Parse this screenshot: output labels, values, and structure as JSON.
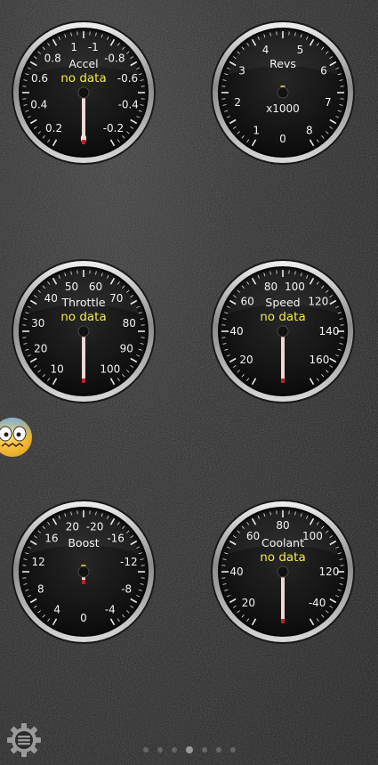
{
  "gauges": [
    {
      "id": "accel",
      "title": "Accel",
      "subtitle": "",
      "value": "no data",
      "labels": [
        {
          "text": "1",
          "angle": -12
        },
        {
          "text": "-1",
          "angle": 12
        },
        {
          "text": "0.8",
          "angle": -42
        },
        {
          "text": "-0.8",
          "angle": 42
        },
        {
          "text": "0.6",
          "angle": -72
        },
        {
          "text": "-0.6",
          "angle": 72
        },
        {
          "text": "0.4",
          "angle": -105
        },
        {
          "text": "-0.4",
          "angle": 105
        },
        {
          "text": "0.2",
          "angle": -140
        },
        {
          "text": "-0.2",
          "angle": 140
        },
        {
          "text": "0",
          "angle": 180
        }
      ],
      "needle_angle": 180
    },
    {
      "id": "revs",
      "title": "Revs",
      "subtitle": "x1000",
      "value": "-",
      "labels": [
        {
          "text": "4",
          "angle": -22
        },
        {
          "text": "5",
          "angle": 22
        },
        {
          "text": "3",
          "angle": -62
        },
        {
          "text": "6",
          "angle": 62
        },
        {
          "text": "2",
          "angle": -102
        },
        {
          "text": "7",
          "angle": 102
        },
        {
          "text": "1",
          "angle": -145
        },
        {
          "text": "8",
          "angle": 145
        },
        {
          "text": "0",
          "angle": 180
        }
      ],
      "needle_angle": null
    },
    {
      "id": "throttle",
      "title": "Throttle",
      "subtitle": "",
      "value": "no data",
      "labels": [
        {
          "text": "50",
          "angle": -15
        },
        {
          "text": "60",
          "angle": 15
        },
        {
          "text": "40",
          "angle": -45
        },
        {
          "text": "70",
          "angle": 45
        },
        {
          "text": "30",
          "angle": -80
        },
        {
          "text": "80",
          "angle": 80
        },
        {
          "text": "20",
          "angle": -112
        },
        {
          "text": "90",
          "angle": 112
        },
        {
          "text": "10",
          "angle": -145
        },
        {
          "text": "100",
          "angle": 145
        }
      ],
      "needle_angle": 180
    },
    {
      "id": "speed",
      "title": "Speed",
      "subtitle": "",
      "value": "no data",
      "labels": [
        {
          "text": "80",
          "angle": -15
        },
        {
          "text": "100",
          "angle": 15
        },
        {
          "text": "60",
          "angle": -50
        },
        {
          "text": "120",
          "angle": 50
        },
        {
          "text": "40",
          "angle": -90
        },
        {
          "text": "140",
          "angle": 90
        },
        {
          "text": "20",
          "angle": -128
        },
        {
          "text": "160",
          "angle": 128
        }
      ],
      "needle_angle": 180
    },
    {
      "id": "boost",
      "title": "Boost",
      "subtitle": "",
      "value": "-",
      "labels": [
        {
          "text": "20",
          "angle": -14
        },
        {
          "text": "-20",
          "angle": 14
        },
        {
          "text": "16",
          "angle": -44
        },
        {
          "text": "-16",
          "angle": 44
        },
        {
          "text": "12",
          "angle": -78
        },
        {
          "text": "-12",
          "angle": 78
        },
        {
          "text": "8",
          "angle": -112
        },
        {
          "text": "-8",
          "angle": 112
        },
        {
          "text": "4",
          "angle": -145
        },
        {
          "text": "-4",
          "angle": 145
        },
        {
          "text": "0",
          "angle": 180
        }
      ],
      "needle_angle": 180,
      "needle_short": true
    },
    {
      "id": "coolant",
      "title": "Coolant",
      "subtitle": "",
      "value": "no data",
      "labels": [
        {
          "text": "80",
          "angle": 0
        },
        {
          "text": "60",
          "angle": -40
        },
        {
          "text": "100",
          "angle": 40
        },
        {
          "text": "40",
          "angle": -90
        },
        {
          "text": "120",
          "angle": 90
        },
        {
          "text": "20",
          "angle": -132
        },
        {
          "text": "-40",
          "angle": 132
        }
      ],
      "needle_angle": 180
    }
  ],
  "pager": {
    "count": 7,
    "active": 3
  },
  "icons": {
    "settings": "settings-gear-icon",
    "emoji": "scared-emoji-icon"
  },
  "colors": {
    "value_text": "#f2e94a",
    "needle": "#f3d6d6",
    "needle_tip": "#c0202a",
    "bezel": "#b8b8b8",
    "face": "#0c0c0c"
  }
}
